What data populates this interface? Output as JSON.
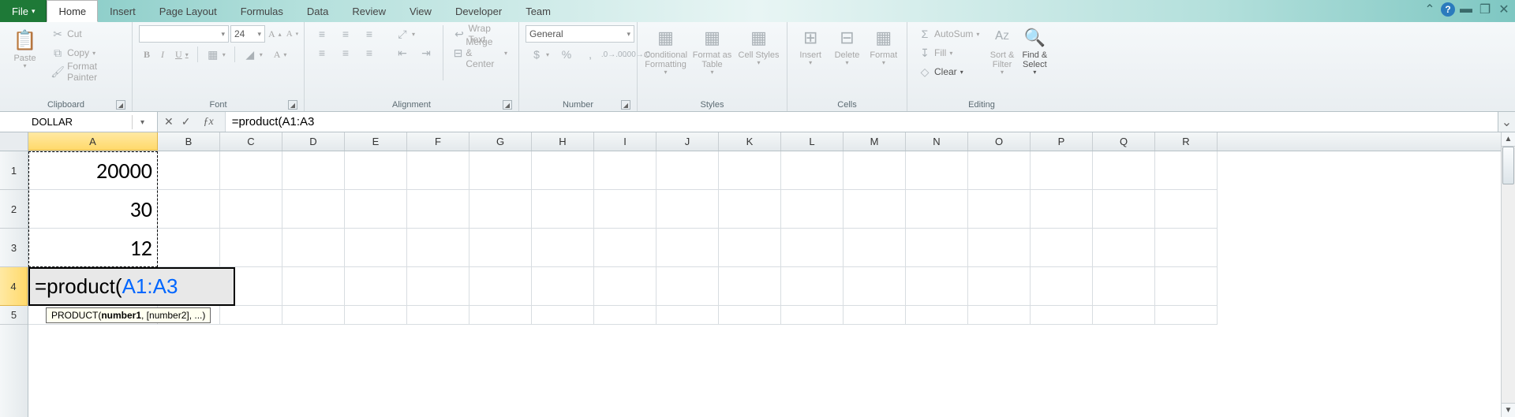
{
  "tabs": {
    "file": "File",
    "home": "Home",
    "insert": "Insert",
    "page_layout": "Page Layout",
    "formulas": "Formulas",
    "data": "Data",
    "review": "Review",
    "view": "View",
    "developer": "Developer",
    "team": "Team"
  },
  "ribbon": {
    "clipboard": {
      "label": "Clipboard",
      "paste": "Paste",
      "cut": "Cut",
      "copy": "Copy",
      "format_painter": "Format Painter"
    },
    "font": {
      "label": "Font",
      "font_name": "",
      "font_size": "24"
    },
    "alignment": {
      "label": "Alignment",
      "wrap_text": "Wrap Text",
      "merge_center": "Merge & Center"
    },
    "number": {
      "label": "Number",
      "format": "General"
    },
    "styles": {
      "label": "Styles",
      "conditional": "Conditional Formatting",
      "as_table": "Format as Table",
      "cell_styles": "Cell Styles"
    },
    "cells": {
      "label": "Cells",
      "insert": "Insert",
      "delete": "Delete",
      "format": "Format"
    },
    "editing": {
      "label": "Editing",
      "autosum": "AutoSum",
      "fill": "Fill",
      "clear": "Clear",
      "sort_filter": "Sort & Filter",
      "find_select": "Find & Select"
    }
  },
  "formula_bar": {
    "name_box": "DOLLAR",
    "formula": "=product(A1:A3"
  },
  "columns": [
    "A",
    "B",
    "C",
    "D",
    "E",
    "F",
    "G",
    "H",
    "I",
    "J",
    "K",
    "L",
    "M",
    "N",
    "O",
    "P",
    "Q",
    "R"
  ],
  "col_widths": {
    "A": 164,
    "default": 79
  },
  "rows": [
    1,
    2,
    3,
    4,
    5
  ],
  "row_heights": {
    "1": 49,
    "2": 49,
    "3": 49,
    "4": 49,
    "5": 24
  },
  "cells": {
    "A1": "20000",
    "A2": "30",
    "A3": "12",
    "A4_prefix": "=product(",
    "A4_ref": "A1:A3"
  },
  "tooltip": {
    "text_prefix": "PRODUCT(",
    "text_bold": "number1",
    "text_suffix": ", [number2], ...)"
  },
  "title_controls": {
    "help": "?"
  }
}
